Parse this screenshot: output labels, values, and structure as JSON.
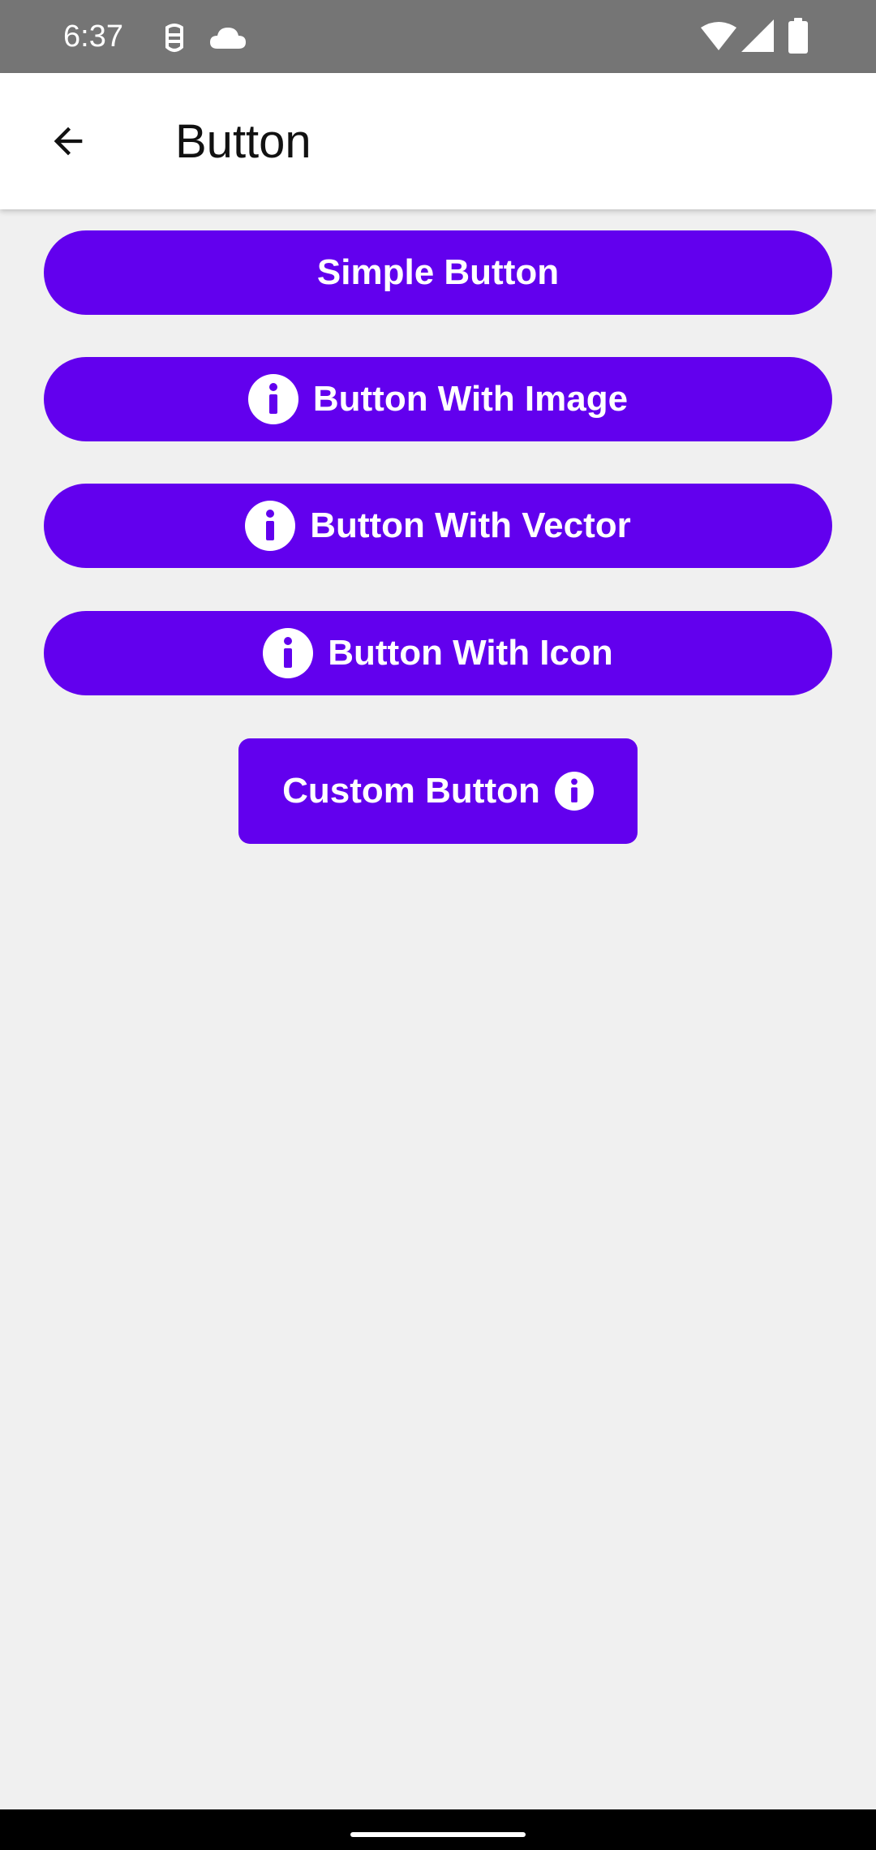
{
  "status_bar": {
    "time": "6:37",
    "icons": [
      "debug-icon",
      "cloud-icon",
      "wifi-icon",
      "signal-icon",
      "battery-icon"
    ]
  },
  "app_bar": {
    "title": "Button",
    "back_icon": "arrow-back-icon"
  },
  "buttons": {
    "simple": {
      "label": "Simple Button"
    },
    "image": {
      "label": "Button With Image",
      "icon": "info-icon"
    },
    "vector": {
      "label": "Button With Vector",
      "icon": "info-icon"
    },
    "icon": {
      "label": "Button With Icon",
      "icon": "info-icon"
    },
    "custom": {
      "label": "Custom Button",
      "icon": "info-icon"
    }
  },
  "colors": {
    "primary": "#6200ee",
    "background": "#f0f0f0",
    "status_bar": "#757575",
    "app_bar": "#ffffff",
    "nav_bar": "#000000"
  }
}
